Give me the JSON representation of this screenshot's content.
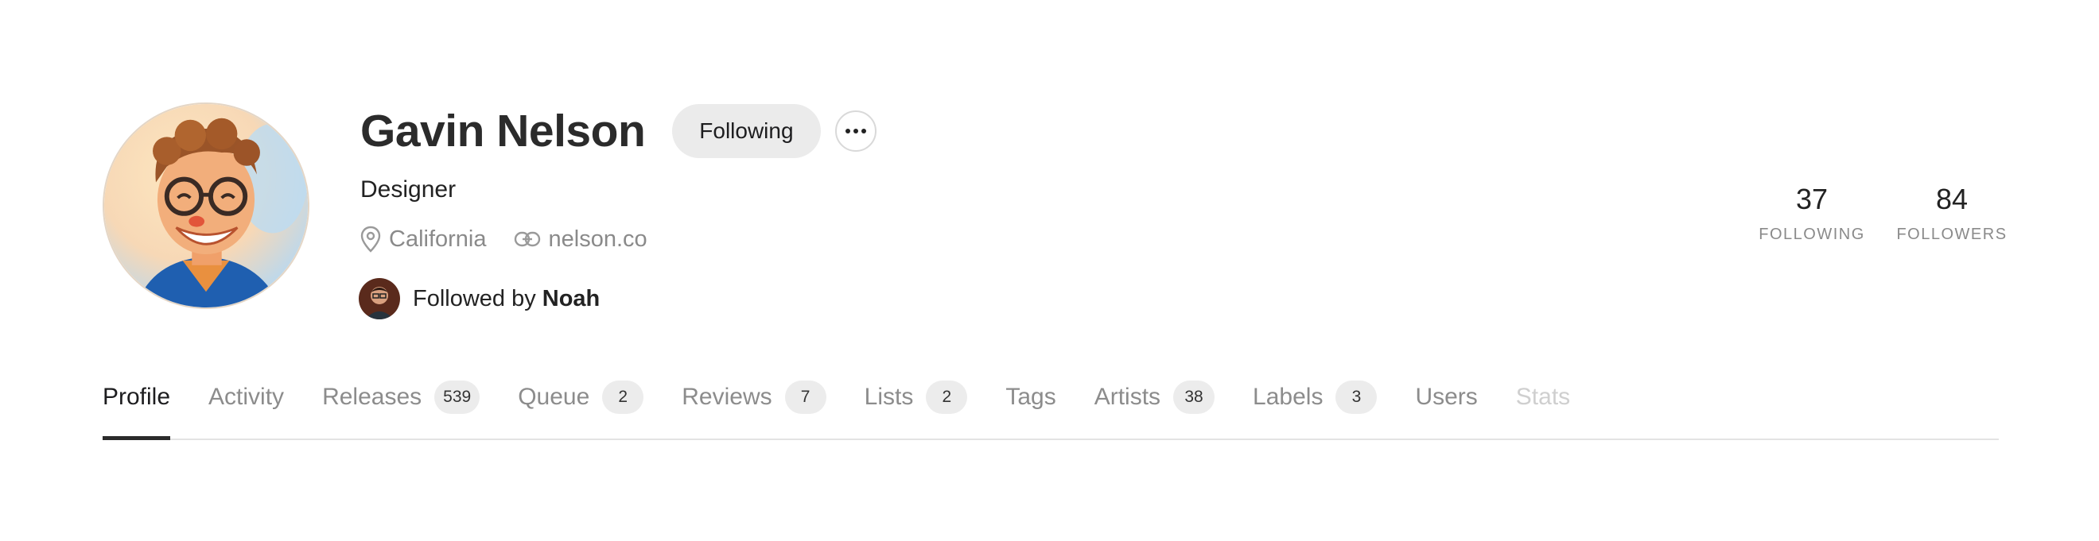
{
  "profile": {
    "name": "Gavin Nelson",
    "follow_button": "Following",
    "more_button_icon": "more-horizontal-icon",
    "role": "Designer",
    "location": "California",
    "website": "nelson.co",
    "followed_by_prefix": "Followed by",
    "followed_by_name": "Noah"
  },
  "stats": {
    "following": {
      "value": "37",
      "label": "FOLLOWING"
    },
    "followers": {
      "value": "84",
      "label": "FOLLOWERS"
    }
  },
  "tabs": [
    {
      "label": "Profile",
      "active": true
    },
    {
      "label": "Activity"
    },
    {
      "label": "Releases",
      "count": "539"
    },
    {
      "label": "Queue",
      "count": "2"
    },
    {
      "label": "Reviews",
      "count": "7"
    },
    {
      "label": "Lists",
      "count": "2"
    },
    {
      "label": "Tags"
    },
    {
      "label": "Artists",
      "count": "38"
    },
    {
      "label": "Labels",
      "count": "3"
    },
    {
      "label": "Users"
    },
    {
      "label": "Stats",
      "disabled": true
    }
  ]
}
